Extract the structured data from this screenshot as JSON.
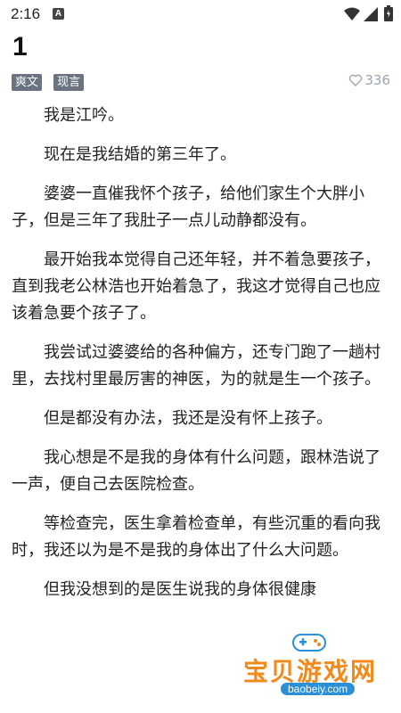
{
  "status_bar": {
    "time": "2:16",
    "notification_badge": "A"
  },
  "chapter": {
    "title": "1"
  },
  "tags": [
    "爽文",
    "现言"
  ],
  "likes": {
    "count": "336"
  },
  "paragraphs": [
    "我是江吟。",
    "现在是我结婚的第三年了。",
    "婆婆一直催我怀个孩子，给他们家生个大胖小子，但是三年了我肚子一点儿动静都没有。",
    "最开始我本觉得自己还年轻，并不着急要孩子，直到我老公林浩也开始着急了，我这才觉得自己也应该着急要个孩子了。",
    "我尝试过婆婆给的各种偏方，还专门跑了一趟村里，去找村里最厉害的神医，为的就是生一个孩子。",
    "但是都没有办法，我还是没有怀上孩子。",
    "我心想是不是我的身体有什么问题，跟林浩说了一声，便自己去医院检查。",
    "等检查完，医生拿着检查单，有些沉重的看向我时，我还以为是不是我的身体出了什么大问题。",
    "但我没想到的是医生说我的身体很健康"
  ],
  "watermark": {
    "name": "宝贝游戏网",
    "url": "baobeiy.com"
  },
  "colors": {
    "tag_bg": "#6b7280",
    "watermark_orange": "#f08a1a",
    "watermark_blue": "#2b8fd8"
  }
}
